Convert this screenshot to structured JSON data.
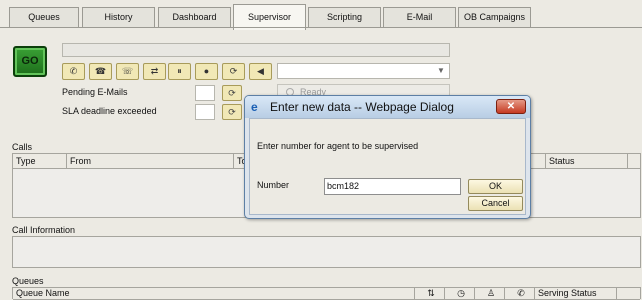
{
  "tabs": [
    {
      "label": "Queues"
    },
    {
      "label": "History"
    },
    {
      "label": "Dashboard"
    },
    {
      "label": "Supervisor",
      "active": true
    },
    {
      "label": "Scripting"
    },
    {
      "label": "E-Mail"
    },
    {
      "label": "OB Campaigns"
    }
  ],
  "toolbar": {
    "go_label": "GO",
    "status_placeholder": "",
    "ready_label": "Ready",
    "buttons": [
      {
        "icon": "phone-icon",
        "glyph": "✆"
      },
      {
        "icon": "hangup-icon",
        "glyph": "☎"
      },
      {
        "icon": "conference-icon",
        "glyph": "☏"
      },
      {
        "icon": "transfer-icon",
        "glyph": "⇄"
      },
      {
        "icon": "hold-icon",
        "glyph": "⏸"
      },
      {
        "icon": "record-icon",
        "glyph": "●"
      },
      {
        "icon": "refresh-icon",
        "glyph": "⟳"
      },
      {
        "icon": "mute-icon",
        "glyph": "◀"
      }
    ]
  },
  "fields": {
    "pending_emails_label": "Pending E-Mails",
    "sla_label": "SLA deadline exceeded"
  },
  "calls": {
    "title": "Calls",
    "columns": [
      "Type",
      "From",
      "To",
      "Status"
    ]
  },
  "call_information": {
    "title": "Call Information"
  },
  "queues": {
    "title": "Queues",
    "columns": [
      "Queue Name",
      "Serving Status"
    ]
  },
  "dialog": {
    "title": "Enter new data -- Webpage Dialog",
    "prompt": "Enter number for agent to be supervised",
    "number_label": "Number",
    "number_value": "bcm182",
    "ok_label": "OK",
    "cancel_label": "Cancel",
    "close_glyph": "✕"
  },
  "colors": {
    "accent": "#2e8b2b",
    "dialog_close": "#c63a22"
  }
}
